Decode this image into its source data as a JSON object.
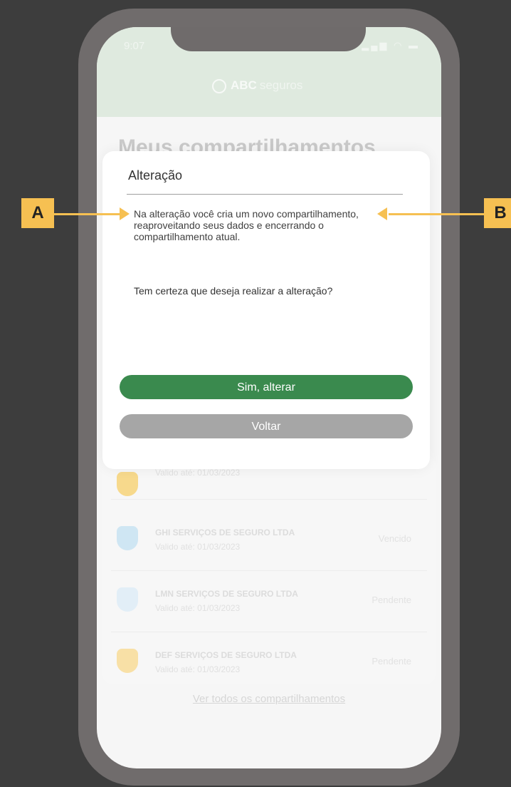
{
  "status": {
    "time": "9:07",
    "icons": "▂▄▆ ◠ ▬"
  },
  "header": {
    "brand": "ABC",
    "brand_sub": "seguros"
  },
  "page": {
    "title": "Meus compartilhamentos"
  },
  "background_list": [
    {
      "name": "",
      "date": "Valido até: 01/03/2023",
      "status": "",
      "icon_color": "#f7d98c"
    },
    {
      "name": "GHI SERVIÇOS DE SEGURO LTDA",
      "date": "Valido até: 01/03/2023",
      "status": "Vencido",
      "icon_color": "#cfe6f3"
    },
    {
      "name": "LMN SERVIÇOS DE SEGURO LTDA",
      "date": "Valido até: 01/03/2023",
      "status": "Pendente",
      "icon_color": "#e2eef7"
    },
    {
      "name": "DEF SERVIÇOS DE SEGURO LTDA",
      "date": "Valido até: 01/03/2023",
      "status": "Pendente",
      "icon_color": "#f8e0a6"
    }
  ],
  "background_link": "Ver todos os compartilhamentos",
  "dialog": {
    "title": "Alteração",
    "body": "Na alteração você cria um novo compartilhamento, reaproveitando seus dados e encerrando o compartilhamento atual.",
    "question": "Tem certeza que deseja realizar a alteração?",
    "confirm_label": "Sim, alterar",
    "back_label": "Voltar"
  },
  "annotations": {
    "a": "A",
    "b": "B"
  },
  "colors": {
    "primary": "#3a8a4e",
    "secondary": "#a6a6a6",
    "marker": "#f6c052"
  }
}
